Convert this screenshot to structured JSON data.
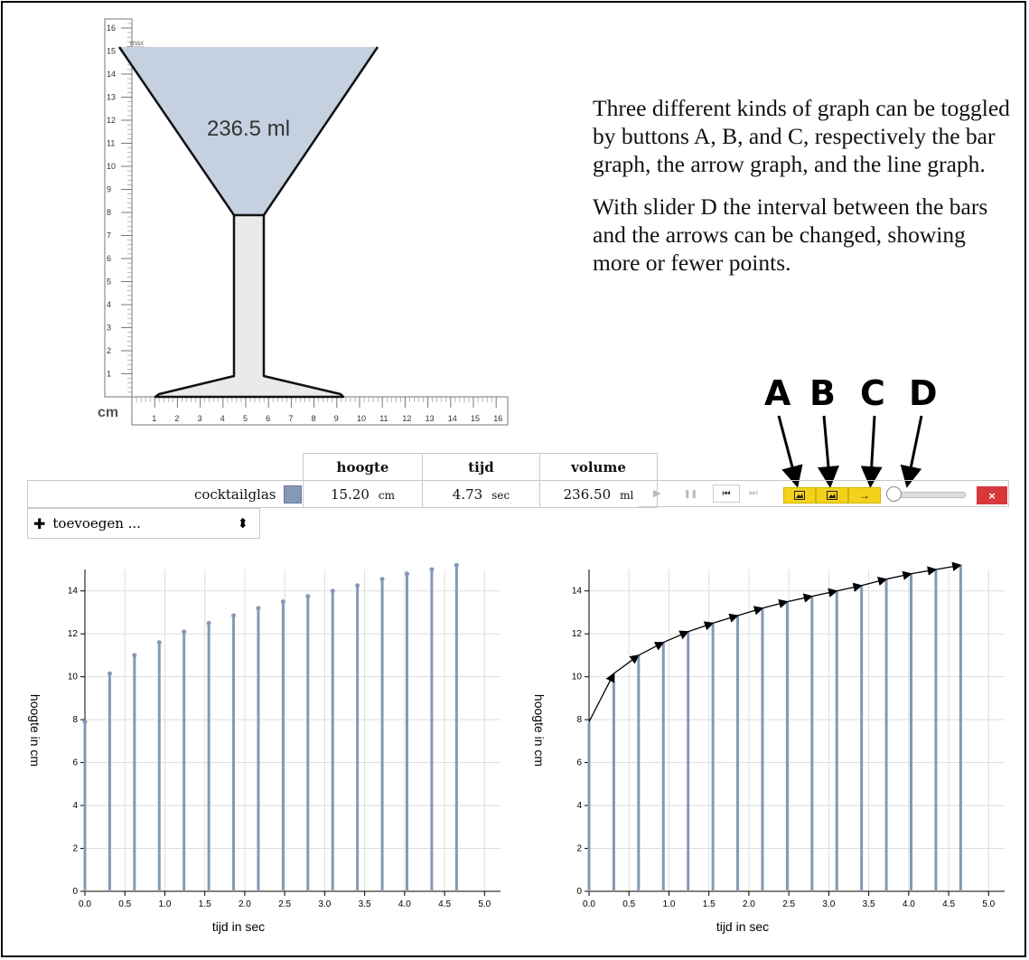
{
  "glass": {
    "volume_label": "236.5 ml",
    "max_label": "max",
    "unit_label": "cm",
    "y_ticks": [
      1,
      2,
      3,
      4,
      5,
      6,
      7,
      8,
      9,
      10,
      11,
      12,
      13,
      14,
      15,
      16
    ],
    "x_ticks": [
      1,
      2,
      3,
      4,
      5,
      6,
      7,
      8,
      9,
      10,
      11,
      12,
      13,
      14,
      15,
      16
    ],
    "fill_color": "#c5d1e1",
    "stem_color": "#eaeaea"
  },
  "description": {
    "p1": "Three different kinds of graph can be toggled by buttons A, B, and C, respectively the bar graph, the arrow graph, and the line graph.",
    "p2": "With slider D the interval between the bars and the arrows can be changed, showing more or fewer points."
  },
  "callouts": {
    "a": "A",
    "b": "B",
    "c": "C",
    "d": "D"
  },
  "table": {
    "headers": {
      "height": "hoogte",
      "time": "tijd",
      "volume": "volume"
    },
    "row": {
      "name": "cocktailglas",
      "height_value": "15.20",
      "height_unit": "cm",
      "time_value": "4.73",
      "time_unit": "sec",
      "volume_value": "236.50",
      "volume_unit": "ml"
    },
    "swatch_color": "#8599b6"
  },
  "controls": {
    "play_icon": "▶",
    "pause_icon": "❚❚",
    "rewind_icon": "⏮",
    "forward_icon": "⏭",
    "arrow_btn_icon": "→",
    "close_label": "×",
    "slider_value": 0.0
  },
  "add_select": {
    "label": "toevoegen ...",
    "plus_icon": "✚",
    "caret_icon": "⬍"
  },
  "chart_data": [
    {
      "type": "bar",
      "xlabel": "tijd in sec",
      "ylabel": "hoogte in cm",
      "xlim": [
        0,
        5.2
      ],
      "ylim": [
        0,
        15
      ],
      "x_ticks": [
        "0.0",
        "0.5",
        "1.0",
        "1.5",
        "2.0",
        "2.5",
        "3.0",
        "3.5",
        "4.0",
        "4.5",
        "5.0"
      ],
      "y_ticks": [
        "0",
        "2",
        "4",
        "6",
        "8",
        "10",
        "12",
        "14"
      ],
      "grid": true,
      "x": [
        0.0,
        0.31,
        0.62,
        0.93,
        1.24,
        1.55,
        1.86,
        2.17,
        2.48,
        2.79,
        3.1,
        3.41,
        3.72,
        4.03,
        4.34,
        4.65
      ],
      "values": [
        7.9,
        10.15,
        11.0,
        11.6,
        12.1,
        12.5,
        12.85,
        13.2,
        13.5,
        13.75,
        14.0,
        14.25,
        14.55,
        14.8,
        15.0,
        15.2
      ],
      "bar_color": "#8599b6"
    },
    {
      "type": "line",
      "xlabel": "tijd in sec",
      "ylabel": "hoogte in cm",
      "xlim": [
        0,
        5.2
      ],
      "ylim": [
        0,
        15
      ],
      "x_ticks": [
        "0.0",
        "0.5",
        "1.0",
        "1.5",
        "2.0",
        "2.5",
        "3.0",
        "3.5",
        "4.0",
        "4.5",
        "5.0"
      ],
      "y_ticks": [
        "0",
        "2",
        "4",
        "6",
        "8",
        "10",
        "12",
        "14"
      ],
      "grid": true,
      "x": [
        0.0,
        0.31,
        0.62,
        0.93,
        1.24,
        1.55,
        1.86,
        2.17,
        2.48,
        2.79,
        3.1,
        3.41,
        3.72,
        4.03,
        4.34,
        4.65
      ],
      "values": [
        7.9,
        10.15,
        11.0,
        11.6,
        12.1,
        12.5,
        12.85,
        13.2,
        13.5,
        13.75,
        14.0,
        14.25,
        14.55,
        14.8,
        15.0,
        15.2
      ],
      "bar_color": "#8599b6",
      "line_color": "#000000"
    }
  ]
}
